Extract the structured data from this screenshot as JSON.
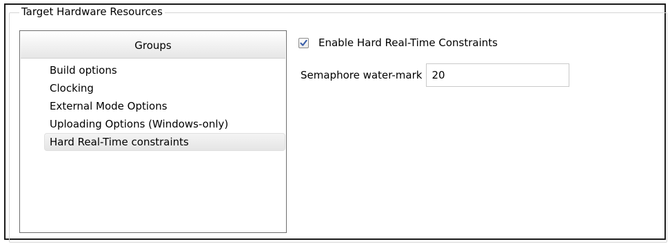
{
  "groupbox": {
    "title": "Target Hardware Resources"
  },
  "groups_panel": {
    "header": "Groups",
    "items": [
      {
        "label": "Build options",
        "selected": false
      },
      {
        "label": "Clocking",
        "selected": false
      },
      {
        "label": "External Mode Options",
        "selected": false
      },
      {
        "label": "Uploading Options (Windows-only)",
        "selected": false
      },
      {
        "label": "Hard Real-Time constraints",
        "selected": true
      }
    ]
  },
  "settings": {
    "enable_hard_rt": {
      "label": "Enable Hard Real-Time Constraints",
      "checked": true,
      "check_color": "#3a5ea8"
    },
    "semaphore": {
      "label": "Semaphore water-mark",
      "value": "20"
    }
  }
}
